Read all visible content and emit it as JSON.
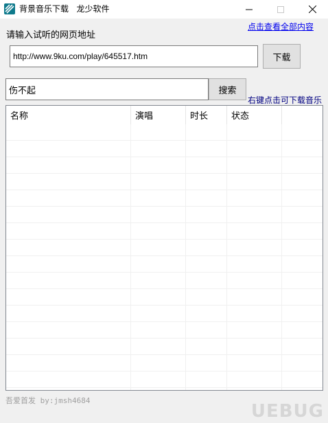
{
  "window": {
    "title": "背景音乐下载   龙少软件"
  },
  "links": {
    "view_all": "点击查看全部内容"
  },
  "url_section": {
    "label": "请输入试听的网页地址",
    "value": "http://www.9ku.com/play/645517.htm",
    "download_button": "下载"
  },
  "search": {
    "value": "伤不起",
    "button": "搜索",
    "hint": "右键点击可下载音乐"
  },
  "table": {
    "columns": [
      "名称",
      "演唱",
      "时长",
      "状态",
      ""
    ],
    "rows": []
  },
  "footer": {
    "credit": "吾爱首发 by:jmsh4684",
    "watermark": "UEBUG"
  },
  "icons": {
    "app": "app-icon",
    "minimize": "minimize-icon",
    "maximize": "maximize-icon",
    "close": "close-icon"
  }
}
